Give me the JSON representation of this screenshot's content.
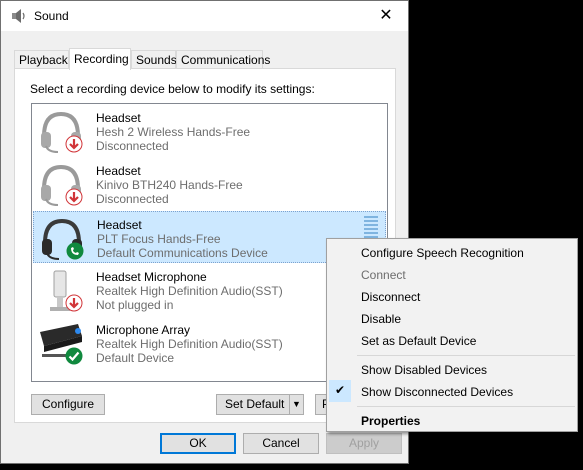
{
  "window": {
    "title": "Sound",
    "close_glyph": "✕"
  },
  "tabs": [
    {
      "label": "Playback"
    },
    {
      "label": "Recording"
    },
    {
      "label": "Sounds"
    },
    {
      "label": "Communications"
    }
  ],
  "panel": {
    "instruction": "Select a recording device below to modify its settings:"
  },
  "devices": [
    {
      "name": "Headset",
      "desc": "Hesh 2 Wireless Hands-Free",
      "status": "Disconnected",
      "badge": "down-arrow-red"
    },
    {
      "name": "Headset",
      "desc": "Kinivo BTH240 Hands-Free",
      "status": "Disconnected",
      "badge": "down-arrow-red"
    },
    {
      "name": "Headset",
      "desc": "PLT Focus Hands-Free",
      "status": "Default Communications Device",
      "badge": "phone-green"
    },
    {
      "name": "Headset Microphone",
      "desc": "Realtek High Definition Audio(SST)",
      "status": "Not plugged in",
      "badge": "down-arrow-red"
    },
    {
      "name": "Microphone Array",
      "desc": "Realtek High Definition Audio(SST)",
      "status": "Default Device",
      "badge": "check-green"
    }
  ],
  "buttons": {
    "configure": "Configure",
    "set_default": "Set Default",
    "properties_partial": "P",
    "ok": "OK",
    "cancel": "Cancel",
    "apply": "Apply"
  },
  "context_menu": {
    "items": [
      {
        "label": "Configure Speech Recognition",
        "enabled": true
      },
      {
        "label": "Connect",
        "enabled": false
      },
      {
        "label": "Disconnect",
        "enabled": true
      },
      {
        "label": "Disable",
        "enabled": true
      },
      {
        "label": "Set as Default Device",
        "enabled": true
      },
      {
        "label": "Show Disabled Devices",
        "enabled": true,
        "checked": false
      },
      {
        "label": "Show Disconnected Devices",
        "enabled": true,
        "checked": true
      },
      {
        "label": "Properties",
        "enabled": true,
        "bold": true
      }
    ],
    "check_glyph": "✔"
  },
  "colors": {
    "selection": "#cce8ff",
    "accent": "#0078d7",
    "disconnected_badge": "#d13438",
    "ok_badge": "#10893e"
  }
}
